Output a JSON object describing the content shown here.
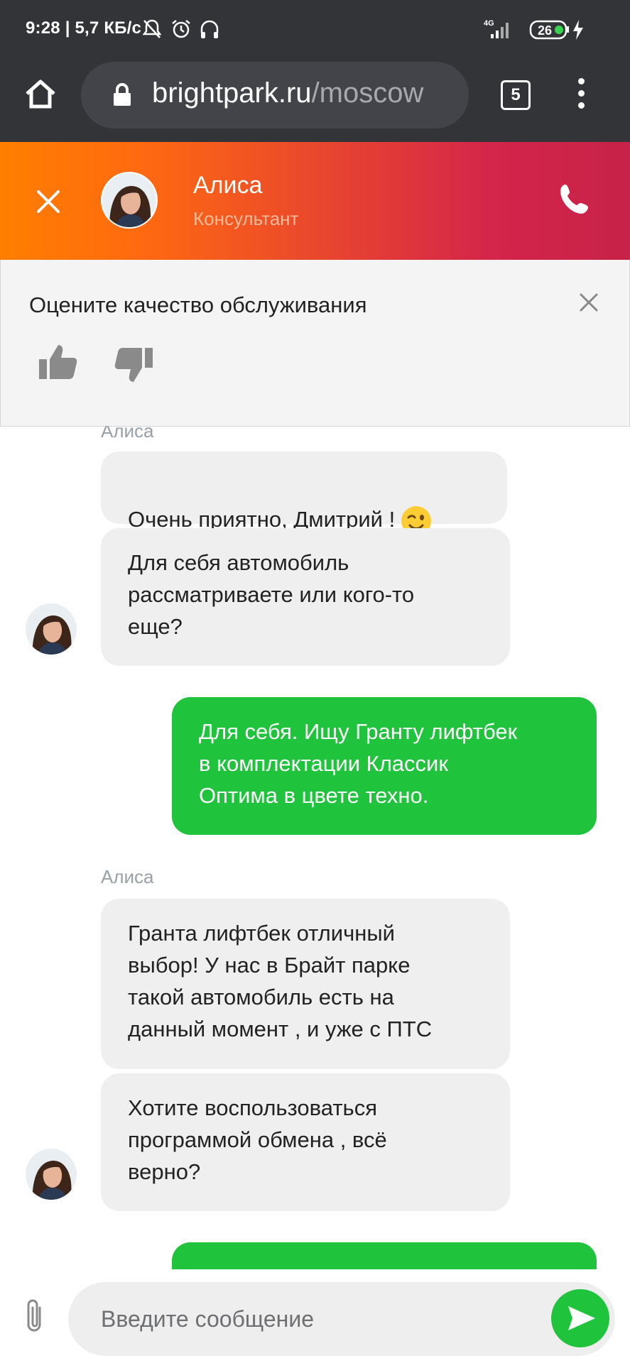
{
  "status_bar": {
    "time_speed": "9:28 | 5,7 КБ/с",
    "network": "4G",
    "battery": "26"
  },
  "browser": {
    "url_domain": "brightpark.ru",
    "url_path": "/moscow",
    "tab_count": "5"
  },
  "chat_header": {
    "agent_name": "Алиса",
    "agent_role": "Консультант"
  },
  "rating": {
    "title": "Оцените качество обслуживания"
  },
  "messages": {
    "sender_1": "Алиса",
    "msg_1": "Очень приятно, Дмитрий !",
    "msg_2": "Для себя автомобиль\nрассматриваете или кого-то\nеще?",
    "msg_3": "Для себя. Ищу Гранту лифтбек\nв комплектации Классик\nОптима в цвете техно.",
    "sender_2": "Алиса",
    "msg_4": "Гранта лифтбек отличный\nвыбор! У нас в Брайт парке\nтакой автомобиль есть на\nданный момент , и уже с ПТС",
    "msg_5": "Хотите воспользоваться\nпрограммой обмена , всё\nверно?"
  },
  "input": {
    "placeholder": "Введите сообщение"
  },
  "colors": {
    "header_gradient_start": "#ff7f00",
    "header_gradient_end": "#c72249",
    "outgoing_bubble": "#1fc33c",
    "incoming_bubble": "#efefef"
  }
}
